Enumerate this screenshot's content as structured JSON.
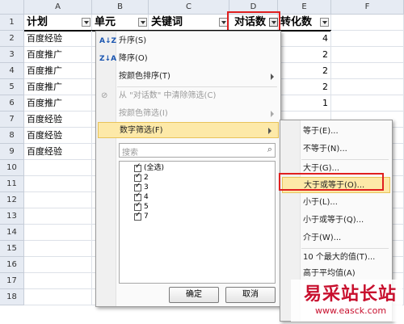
{
  "columns": [
    "A",
    "B",
    "C",
    "D",
    "E",
    "F"
  ],
  "rows": [
    "1",
    "2",
    "3",
    "4",
    "5",
    "6",
    "7",
    "8",
    "9",
    "10",
    "11",
    "12",
    "13",
    "14",
    "15",
    "16",
    "17",
    "18"
  ],
  "header": {
    "a": "计划",
    "b": "单元",
    "c": "关键词",
    "d": "对话数",
    "e": "转化数"
  },
  "col_a": [
    "百度经验",
    "百度推广",
    "百度推广",
    "百度推广",
    "百度推广",
    "百度经验",
    "百度经验",
    "百度经验"
  ],
  "col_e": [
    "4",
    "2",
    "2",
    "2",
    "1",
    "",
    "",
    ""
  ],
  "filter_menu": {
    "sort_asc": "升序(S)",
    "sort_desc": "降序(O)",
    "sort_color": "按颜色排序(T)",
    "clear_filter": "从 \"对话数\" 中清除筛选(C)",
    "filter_color": "按颜色筛选(I)",
    "number_filter": "数字筛选(F)",
    "search_placeholder": "搜索",
    "values": [
      "(全选)",
      "2",
      "3",
      "4",
      "5",
      "7"
    ],
    "ok": "确定",
    "cancel": "取消"
  },
  "submenu": {
    "items": [
      "等于(E)...",
      "不等于(N)...",
      "大于(G)...",
      "大于或等于(O)...",
      "小于(L)...",
      "小于或等于(Q)...",
      "介于(W)...",
      "10 个最大的值(T)...",
      "高于平均值(A)"
    ]
  },
  "watermark": {
    "title": "易采站长站",
    "url": "www.easck.com"
  },
  "colors": {
    "highlight": "#fde9a8",
    "redbox": "#e02020",
    "watermark": "#c8102e"
  }
}
